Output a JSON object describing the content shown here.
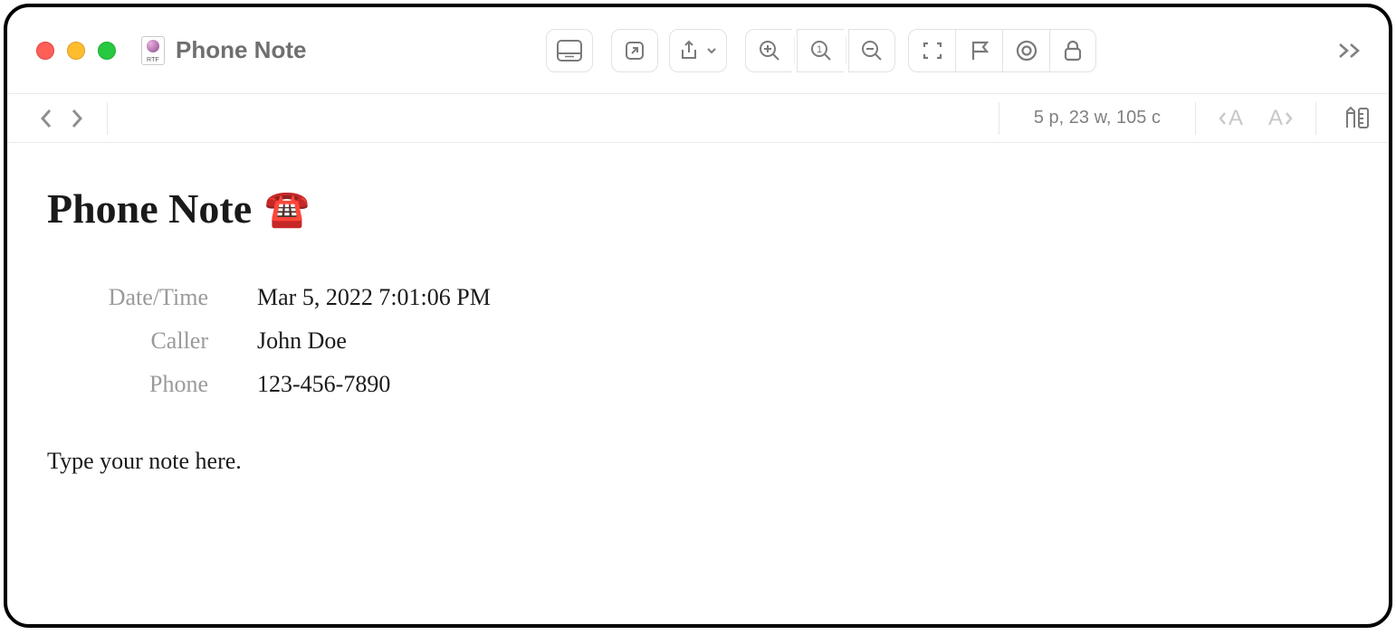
{
  "window": {
    "title": "Phone Note"
  },
  "document": {
    "heading": "Phone Note",
    "emoji": "☎️",
    "fields": {
      "datetime_label": "Date/Time",
      "datetime_value": "Mar 5, 2022 7:01:06 PM",
      "caller_label": "Caller",
      "caller_value": "John Doe",
      "phone_label": "Phone",
      "phone_value": "123-456-7890"
    },
    "body": "Type your note here."
  },
  "status": {
    "counts": "5 p, 23 w, 105 c"
  }
}
